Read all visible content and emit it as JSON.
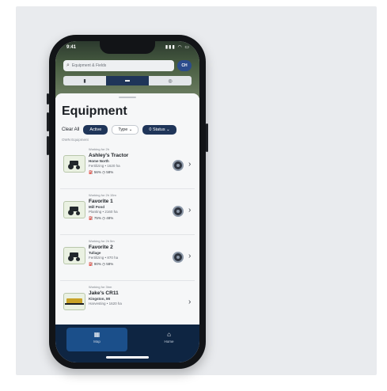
{
  "status": {
    "time": "9:41",
    "icons": "▮▮▮ ◠ ▭"
  },
  "search": {
    "placeholder": "Equipment & Fields",
    "avatar": "CH"
  },
  "segments": [
    {
      "icon": "▮"
    },
    {
      "icon": "▬"
    },
    {
      "icon": "◎"
    }
  ],
  "page": {
    "title": "Equipment"
  },
  "filters": {
    "clear": "Clear All",
    "active": "Active",
    "type": "Type ⌄",
    "status": "0 Status ⌄"
  },
  "section_label": "OWN Equipment",
  "items": [
    {
      "small": "Working for 2h",
      "name": "Ashley's Tractor",
      "sub": "Home North",
      "sub2": "Fertilizing • 1620 ha",
      "stats": "⛽ 56%  ◷ 58%"
    },
    {
      "small": "Working for 2h 15m",
      "name": "Favorite 1",
      "sub": "Mill Pond",
      "sub2": "Planting • 2160 ha",
      "stats": "⛽ 75%  ◷ 48%"
    },
    {
      "small": "Working for 2h 5m",
      "name": "Favorite 2",
      "sub": "Tullage",
      "sub2": "Fertilizing • 870 ha",
      "stats": "⛽ 90%  ◷ 58%"
    },
    {
      "small": "Working for 3hm",
      "name": "Jake's CR11",
      "sub": "Kingston, MI",
      "sub2": "Harvesting • 1620 ha",
      "stats": ""
    }
  ],
  "tabs": [
    {
      "icon": "▦",
      "label": "Map"
    },
    {
      "icon": "⌂",
      "label": "Home"
    }
  ]
}
